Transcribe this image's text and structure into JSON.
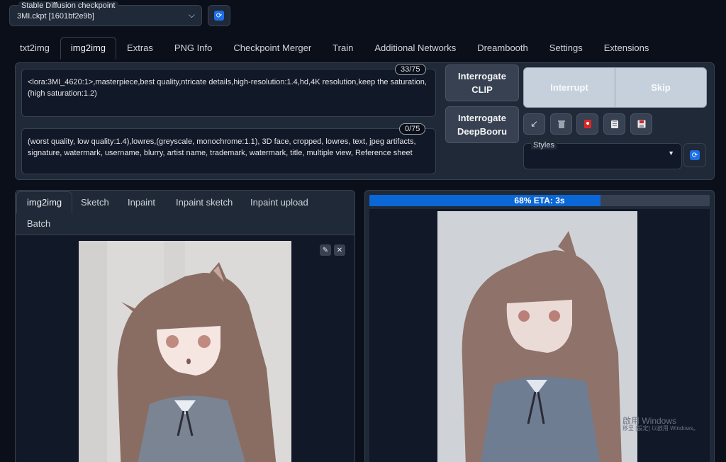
{
  "checkpoint": {
    "label": "Stable Diffusion checkpoint",
    "value": "3MI.ckpt [1601bf2e9b]"
  },
  "tabs": [
    "txt2img",
    "img2img",
    "Extras",
    "PNG Info",
    "Checkpoint Merger",
    "Train",
    "Additional Networks",
    "Dreambooth",
    "Settings",
    "Extensions"
  ],
  "active_tab": "img2img",
  "prompt": {
    "text": "<lora:3MI_4620:1>,masterpiece,best quality,ntricate details,high-resolution:1.4,hd,4K resolution,keep the saturation,(high saturation:1.2)",
    "counter": "33/75"
  },
  "negative_prompt": {
    "text": "(worst quality, low quality:1.4),lowres,(greyscale, monochrome:1.1), 3D face, cropped, lowres, text, jpeg artifacts, signature, watermark, username, blurry, artist name, trademark, watermark, title, multiple view, Reference sheet",
    "counter": "0/75"
  },
  "buttons": {
    "interrogate_clip": "Interrogate CLIP",
    "interrogate_deepbooru": "Interrogate DeepBooru",
    "interrupt": "Interrupt",
    "skip": "Skip"
  },
  "tool_icons": [
    "arrow-down-left-icon",
    "trash-icon",
    "red-card-icon",
    "clipboard-icon",
    "save-icon"
  ],
  "styles": {
    "label": "Styles",
    "value": ""
  },
  "subtabs": [
    "img2img",
    "Sketch",
    "Inpaint",
    "Inpaint sketch",
    "Inpaint upload",
    "Batch"
  ],
  "active_subtab": "img2img",
  "progress": {
    "text": "68% ETA: 3s",
    "fraction": 0.68
  },
  "watermark": {
    "line1": "啟用 Windows",
    "line2": "移至 [設定] 以啟用 Windows。"
  },
  "colors": {
    "accent": "#0b67d6",
    "panel": "#1f2937",
    "background": "#0b0f19"
  }
}
